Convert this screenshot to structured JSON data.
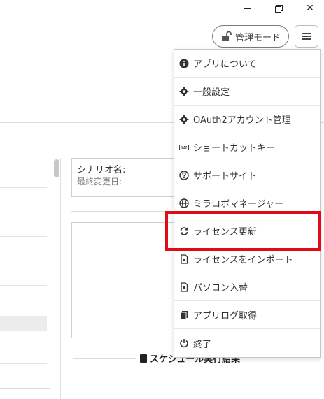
{
  "window": {
    "minimize_icon": "minimize-icon",
    "restore_icon": "restore-icon",
    "close_icon": "close-icon",
    "close_glyph": "✕"
  },
  "header": {
    "admin_mode_label": "管理モード",
    "admin_icon": "unlock-icon",
    "menu_icon": "hamburger-icon"
  },
  "scenario": {
    "name_label": "シナリオ名:",
    "last_modified_label": "最終変更日:"
  },
  "schedule": {
    "title": "スケジュール実行結果"
  },
  "menu": {
    "items": [
      {
        "label": "アプリについて",
        "icon": "info-icon"
      },
      {
        "label": "一般設定",
        "icon": "gear-icon"
      },
      {
        "label": "OAuth2アカウント管理",
        "icon": "gear-icon"
      },
      {
        "label": "ショートカットキー",
        "icon": "keyboard-icon"
      },
      {
        "label": "サポートサイト",
        "icon": "question-icon"
      },
      {
        "label": "ミラロボマネージャー",
        "icon": "globe-icon"
      },
      {
        "label": "ライセンス更新",
        "icon": "sync-icon"
      },
      {
        "label": "ライセンスをインポート",
        "icon": "file-icon"
      },
      {
        "label": "パソコン入替",
        "icon": "file-icon"
      },
      {
        "label": "アプリログ取得",
        "icon": "copy-icon"
      },
      {
        "label": "終了",
        "icon": "power-icon"
      }
    ]
  },
  "highlight": {
    "color": "#e10a17",
    "target": "ライセンス更新"
  }
}
